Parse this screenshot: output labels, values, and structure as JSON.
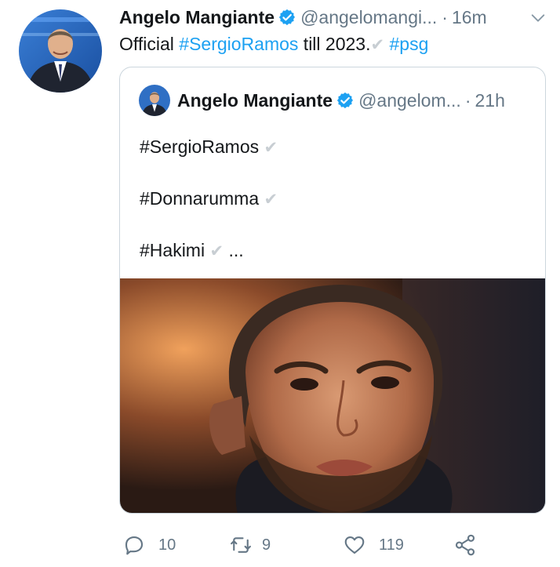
{
  "tweet": {
    "author_name": "Angelo Mangiante",
    "handle": "@angelomangi...",
    "separator": "·",
    "time": "16m",
    "text_parts": [
      "Official ",
      "#SergioRamos",
      " till 2023.",
      "✔",
      " ",
      "#psg"
    ]
  },
  "quoted_tweet": {
    "author_name": "Angelo Mangiante",
    "handle": "@angelom...",
    "separator": "·",
    "time": "21h",
    "lines": [
      {
        "tag": "#SergioRamos",
        "mark": "✔",
        "extra": ""
      },
      {
        "tag": "#Donnarumma",
        "mark": "✔",
        "extra": ""
      },
      {
        "tag": "#Hakimi",
        "mark": "✔",
        "extra": " ..."
      }
    ]
  },
  "actions": {
    "reply_count": "10",
    "retweet_count": "9",
    "like_count": "119"
  },
  "icons": {
    "verified": "verified-badge-icon",
    "caret": "chevron-down-icon",
    "reply": "reply-icon",
    "retweet": "retweet-icon",
    "like": "heart-icon",
    "share": "share-icon"
  },
  "colors": {
    "accent": "#1da1f2",
    "secondary_text": "#657786",
    "border": "#ccd6dd"
  }
}
